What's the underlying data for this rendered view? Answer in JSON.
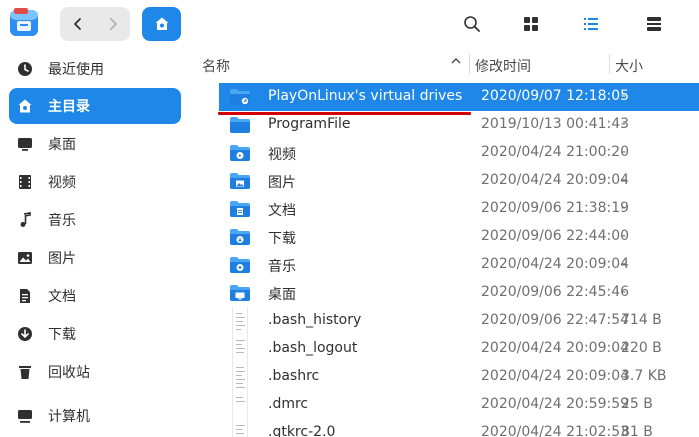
{
  "toolbar": {
    "back": "back-icon",
    "forward": "forward-icon",
    "home": "home-icon",
    "search": "search-icon",
    "icon_view": "grid-view-icon",
    "list_view": "list-view-icon",
    "details": "details-panel-icon"
  },
  "sidebar": {
    "items": [
      {
        "label": "最近使用",
        "icon": "recent-icon"
      },
      {
        "label": "主目录",
        "icon": "home-icon",
        "active": true
      },
      {
        "label": "桌面",
        "icon": "desktop-icon"
      },
      {
        "label": "视频",
        "icon": "video-icon"
      },
      {
        "label": "音乐",
        "icon": "music-icon"
      },
      {
        "label": "图片",
        "icon": "picture-icon"
      },
      {
        "label": "文档",
        "icon": "document-icon"
      },
      {
        "label": "下载",
        "icon": "download-icon"
      },
      {
        "label": "回收站",
        "icon": "trash-icon"
      },
      {
        "label": "计算机",
        "icon": "computer-icon"
      }
    ]
  },
  "table": {
    "headers": {
      "name": "名称",
      "modified": "修改时间",
      "size": "大小"
    },
    "rows": [
      {
        "name": "PlayOnLinux's virtual drives",
        "modified": "2020/09/07 12:18:05",
        "size": "-",
        "type": "folder-link",
        "selected": true
      },
      {
        "name": "ProgramFile",
        "modified": "2019/10/13 00:41:43",
        "size": "-",
        "type": "folder"
      },
      {
        "name": "视频",
        "modified": "2020/04/24 21:00:20",
        "size": "-",
        "type": "folder-video"
      },
      {
        "name": "图片",
        "modified": "2020/04/24 20:09:04",
        "size": "-",
        "type": "folder-picture"
      },
      {
        "name": "文档",
        "modified": "2020/09/06 21:38:19",
        "size": "-",
        "type": "folder-document"
      },
      {
        "name": "下载",
        "modified": "2020/09/06 22:44:00",
        "size": "-",
        "type": "folder-download"
      },
      {
        "name": "音乐",
        "modified": "2020/04/24 20:09:04",
        "size": "-",
        "type": "folder-music"
      },
      {
        "name": "桌面",
        "modified": "2020/09/06 22:45:46",
        "size": "-",
        "type": "folder-desktop"
      },
      {
        "name": ".bash_history",
        "modified": "2020/09/06 22:47:54",
        "size": "714 B",
        "type": "text-file"
      },
      {
        "name": ".bash_logout",
        "modified": "2020/04/24 20:09:04",
        "size": "220 B",
        "type": "text-file"
      },
      {
        "name": ".bashrc",
        "modified": "2020/04/24 20:09:04",
        "size": "3.7 KB",
        "type": "text-file"
      },
      {
        "name": ".dmrc",
        "modified": "2020/04/24 20:59:59",
        "size": "25 B",
        "type": "text-file"
      },
      {
        "name": ".gtkrc-2.0",
        "modified": "2020/04/24 21:02:53",
        "size": "81 B",
        "type": "text-file"
      }
    ]
  },
  "colors": {
    "accent": "#1e87e8",
    "annotation": "#d40000"
  }
}
